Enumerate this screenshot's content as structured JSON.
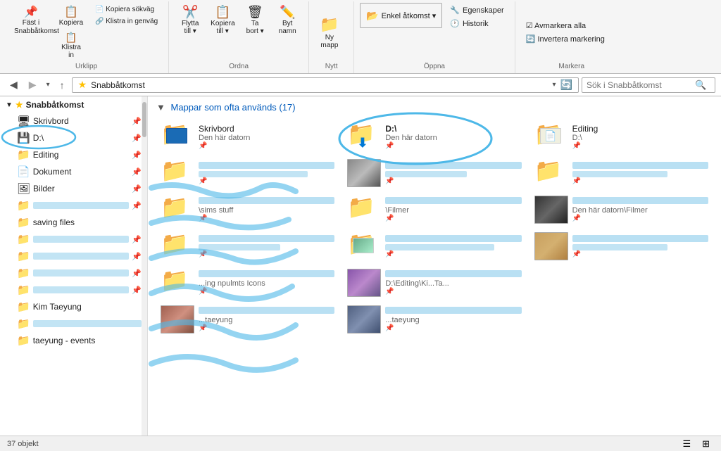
{
  "ribbon": {
    "groups": [
      {
        "title": "Urklipp",
        "buttons": [
          {
            "label": "Fäst i\nSnabbåtkomst",
            "icon": "📌"
          },
          {
            "label": "Kopiera\n",
            "icon": "📋"
          },
          {
            "label": "Klistra\nin",
            "icon": "📋"
          },
          {
            "label": "Kopiera sökväg",
            "icon": ""
          },
          {
            "label": "Klistra in genväg",
            "icon": ""
          }
        ]
      },
      {
        "title": "Ordna",
        "buttons": [
          {
            "label": "Flytta\ntill ▾",
            "icon": ""
          },
          {
            "label": "Kopiera\ntill ▾",
            "icon": ""
          },
          {
            "label": "Ta\nbort ▾",
            "icon": "🗑"
          },
          {
            "label": "Byt\nnamn",
            "icon": ""
          }
        ]
      },
      {
        "title": "Nytt",
        "buttons": [
          {
            "label": "Ny\nmapp",
            "icon": "📁"
          }
        ]
      },
      {
        "title": "Öppna",
        "buttons": [
          {
            "label": "Enkel åtkomst ▾",
            "icon": ""
          },
          {
            "label": "Egenskaper",
            "icon": ""
          },
          {
            "label": "Historik",
            "icon": ""
          }
        ]
      },
      {
        "title": "Markera",
        "buttons": [
          {
            "label": "Avmarkera alla",
            "icon": ""
          },
          {
            "label": "Invertera markering",
            "icon": ""
          }
        ]
      }
    ]
  },
  "addressbar": {
    "back_title": "Bakåt",
    "forward_title": "Framåt",
    "up_title": "Uppåt",
    "path": "Snabbåtkomst",
    "search_placeholder": "Sök i Snabbåtkomst",
    "refresh_title": "Uppdatera"
  },
  "sidebar": {
    "section": "Snabbåtkomst",
    "items": [
      {
        "label": "Snabbåtkomst",
        "icon": "⭐",
        "active": true,
        "indent": 0
      },
      {
        "label": "Skrivbord",
        "icon": "🖥",
        "indent": 1,
        "pin": true
      },
      {
        "label": "D:\\",
        "icon": "💾",
        "indent": 1,
        "pin": true,
        "has_circle": true
      },
      {
        "label": "Editing",
        "icon": "📁",
        "indent": 1,
        "pin": true
      },
      {
        "label": "Dokument",
        "icon": "📄",
        "indent": 1,
        "pin": true
      },
      {
        "label": "Bilder",
        "icon": "🖼",
        "indent": 1,
        "pin": true
      },
      {
        "label": "...",
        "icon": "📁",
        "indent": 1,
        "blurred": true
      },
      {
        "label": "saving files",
        "icon": "📁",
        "indent": 1
      },
      {
        "label": "...",
        "icon": "📁",
        "indent": 1,
        "blurred": true
      },
      {
        "label": "...",
        "icon": "📁",
        "indent": 1,
        "blurred": true
      },
      {
        "label": "...",
        "icon": "📁",
        "indent": 1,
        "blurred": true
      },
      {
        "label": "Kim Taeyung",
        "icon": "📁",
        "indent": 1
      },
      {
        "label": "taeyung...",
        "icon": "📁",
        "indent": 1,
        "blurred": true
      },
      {
        "label": "taeyung - events",
        "icon": "📁",
        "indent": 1
      }
    ]
  },
  "content": {
    "section_title": "Mappar som ofta används (17)",
    "folders": [
      {
        "name": "Skrivbord",
        "sub": "Den här datorn",
        "type": "blue_folder",
        "pin": true
      },
      {
        "name": "D:\\",
        "sub": "Den här datorn",
        "type": "download_folder",
        "pin": true,
        "annotated": true
      },
      {
        "name": "Editing",
        "sub": "D:\\",
        "type": "standard_folder",
        "pin": true
      },
      {
        "name": "Dokument",
        "sub": "Den här datorn",
        "type": "standard_folder",
        "pin": true,
        "blurred_sub": true
      },
      {
        "name": "...",
        "sub": "Den här datorn",
        "type": "photo_folder",
        "pin": true,
        "blurred": true
      },
      {
        "name": "...",
        "sub": "D",
        "type": "standard_folder",
        "pin": true,
        "blurred": true
      },
      {
        "name": "...",
        "sub": "\\sims stuff",
        "type": "standard_folder",
        "pin": true,
        "blurred": true
      },
      {
        "name": "...",
        "sub": "\\Filmer",
        "type": "standard_folder",
        "pin": true,
        "blurred": true
      },
      {
        "name": "...",
        "sub": "Den här datorn\\Filmer",
        "type": "photo_dark",
        "pin": true,
        "blurred": true
      },
      {
        "name": "...",
        "sub": "",
        "type": "standard_folder",
        "pin": true,
        "blurred": true
      },
      {
        "name": "...",
        "sub": "",
        "type": "photo_colorful",
        "pin": true,
        "blurred": true
      },
      {
        "name": "Leotions",
        "sub": "",
        "type": "photo_face",
        "pin": true,
        "blurred_name": true
      },
      {
        "name": "Ki...",
        "sub": "...ing npulmts Icons",
        "type": "standard_folder",
        "pin": true,
        "blurred": true
      },
      {
        "name": "...ts",
        "sub": "D:\\Editing\\Ki...Ta...",
        "type": "photo_purple",
        "pin": true,
        "blurred": true
      },
      {
        "name": "taeny...ts",
        "sub": "...taeyung",
        "type": "photo_face2",
        "pin": true,
        "blurred": true
      },
      {
        "name": "taek...pi",
        "sub": "...taeyung",
        "type": "photo_face3",
        "pin": true,
        "blurred": true
      }
    ]
  },
  "statusbar": {
    "count": "37 objekt",
    "view_list": "☰",
    "view_grid": "⊞"
  }
}
